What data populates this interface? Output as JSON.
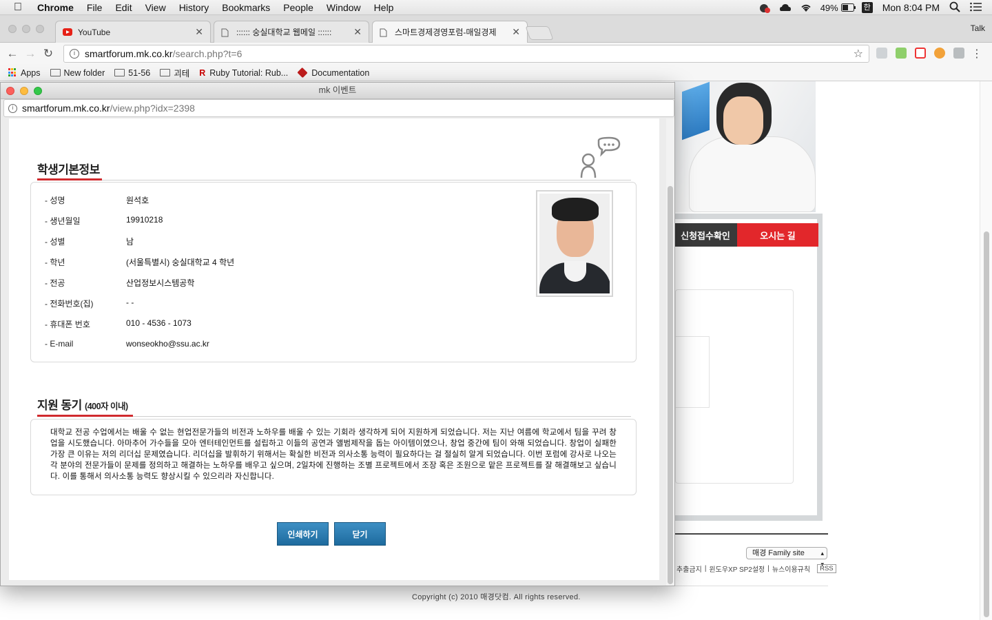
{
  "menubar": {
    "app": "Chrome",
    "items": [
      "File",
      "Edit",
      "View",
      "History",
      "Bookmarks",
      "People",
      "Window",
      "Help"
    ],
    "battery": "49%",
    "ime": "한",
    "clock": "Mon 8:04 PM"
  },
  "tabs": [
    {
      "title": "YouTube",
      "icon": "youtube-icon"
    },
    {
      "title": ":::::: 숭실대학교 웹메일 ::::::",
      "icon": "page-icon"
    },
    {
      "title": "스마트경제경영포럼-매일경제",
      "icon": "page-icon"
    }
  ],
  "profile_label": "Talk",
  "address": {
    "host": "smartforum.mk.co.kr",
    "path": "/search.php?t=6"
  },
  "bookmarks": [
    {
      "label": "Apps",
      "icon": "apps-grid-icon"
    },
    {
      "label": "New folder",
      "icon": "folder-icon"
    },
    {
      "label": "51-56",
      "icon": "folder-icon"
    },
    {
      "label": "괴테",
      "icon": "folder-icon"
    },
    {
      "label": "Ruby Tutorial: Rub...",
      "icon": "ruby-r-icon"
    },
    {
      "label": "Documentation",
      "icon": "ruby-gem-icon"
    }
  ],
  "background_page": {
    "tab_confirm": "신청접수확인",
    "tab_directions": "오시는 길",
    "family_site": "매경 Family site",
    "footer_links": [
      "추출금지",
      "윈도우XP SP2설정",
      "뉴스이용규칙"
    ],
    "rss": "RSS",
    "copyright": "Copyright (c) 2010 매경닷컴. All rights reserved."
  },
  "popup": {
    "title": "mk 이벤트",
    "url_host": "smartforum.mk.co.kr",
    "url_path": "/view.php?idx=2398",
    "section1_title": "학생기본정보",
    "fields": [
      {
        "label": "- 성명",
        "value": "원석호"
      },
      {
        "label": "- 생년월일",
        "value": "19910218"
      },
      {
        "label": "- 성별",
        "value": "남"
      },
      {
        "label": "- 학년",
        "value": "(서울특별시) 숭실대학교 4 학년"
      },
      {
        "label": "- 전공",
        "value": "산업정보시스템공학"
      },
      {
        "label": "- 전화번호(집)",
        "value": "- -"
      },
      {
        "label": "- 휴대폰 번호",
        "value": "010 - 4536 - 1073"
      },
      {
        "label": "- E-mail",
        "value": "wonseokho@ssu.ac.kr"
      }
    ],
    "section2_title": "지원 동기",
    "section2_note": "(400자 이내)",
    "motive": "대학교 전공 수업에서는 배울 수 없는 현업전문가들의 비전과 노하우를 배울 수 있는 기회라 생각하게 되어 지원하게 되었습니다. 저는 지난 여름에 학교에서 팀을 꾸려 창업을 시도했습니다. 아마추어 가수들을 모아 엔터테인먼트를 설립하고 이들의 공연과 앨범제작을 돕는 아이템이였으나, 창업 중간에 팀이 와해 되었습니다. 창업이 실패한 가장 큰 이유는 저의 리더십 문제였습니다. 리더십을 발휘하기 위해서는 확실한 비전과 의사소통 능력이 필요하다는 걸 절실히 알게 되었습니다. 이번 포럼에 강사로 나오는 각 분야의 전문가들이 문제를 정의하고 해결하는 노하우를 배우고 싶으며, 2일차에 진행하는 조별 프로젝트에서 조장 혹은 조원으로 맡은 프로젝트를 잘 해결해보고 싶습니다. 이를 통해서 의사소통 능력도 향상시킬 수 있으리라 자신합니다.",
    "print_button": "인쇄하기",
    "close_button": "닫기"
  },
  "colors": {
    "accent_red": "#d02a2e",
    "button_blue": "#2a7db3",
    "tab_red": "#e2272b"
  }
}
